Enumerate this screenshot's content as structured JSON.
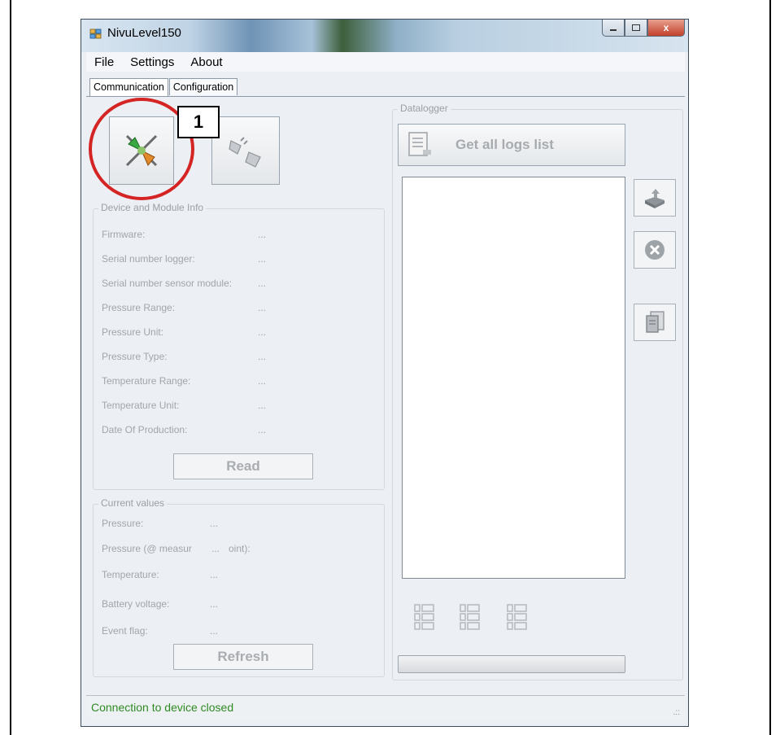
{
  "window": {
    "title": "NivuLevel150",
    "maximize_glyph": "▫",
    "close_glyph": "x"
  },
  "menu": {
    "items": [
      "File",
      "Settings",
      "About"
    ]
  },
  "tabs": [
    "Communication",
    "Configuration"
  ],
  "connect_panel": {
    "connect_icon": "plug-connected-icon",
    "disconnect_icon": "plug-disconnected-icon"
  },
  "device_info": {
    "title": "Device and Module Info",
    "rows": [
      {
        "label": "Firmware:",
        "value": "..."
      },
      {
        "label": "Serial number logger:",
        "value": "..."
      },
      {
        "label": "Serial number sensor module:",
        "value": "..."
      },
      {
        "label": "Pressure Range:",
        "value": "..."
      },
      {
        "label": "Pressure Unit:",
        "value": "..."
      },
      {
        "label": "Pressure Type:",
        "value": "..."
      },
      {
        "label": "Temperature Range:",
        "value": "..."
      },
      {
        "label": "Temperature Unit:",
        "value": "..."
      },
      {
        "label": "Date Of Production:",
        "value": "..."
      }
    ],
    "read_label": "Read"
  },
  "current_values": {
    "title": "Current values",
    "rows": [
      {
        "label": "Pressure:",
        "value": "..."
      },
      {
        "label": "Pressure (@ measur",
        "value": "...",
        "suffix": " oint):"
      },
      {
        "label": "Temperature:",
        "value": "..."
      },
      {
        "label": "Battery voltage:",
        "value": "..."
      },
      {
        "label": "Event flag:",
        "value": "..."
      }
    ],
    "refresh_label": "Refresh"
  },
  "datalogger": {
    "title": "Datalogger",
    "get_logs_label": "Get all logs list",
    "side_icons": [
      "save-disk-icon",
      "delete-circle-icon",
      "export-document-icon"
    ],
    "bottom_icons": [
      "list-view-icon",
      "list-view-icon",
      "list-view-icon"
    ],
    "progress": 0
  },
  "status": {
    "text": "Connection to device closed"
  },
  "annotation": {
    "label": "1",
    "color": "#d42424"
  }
}
